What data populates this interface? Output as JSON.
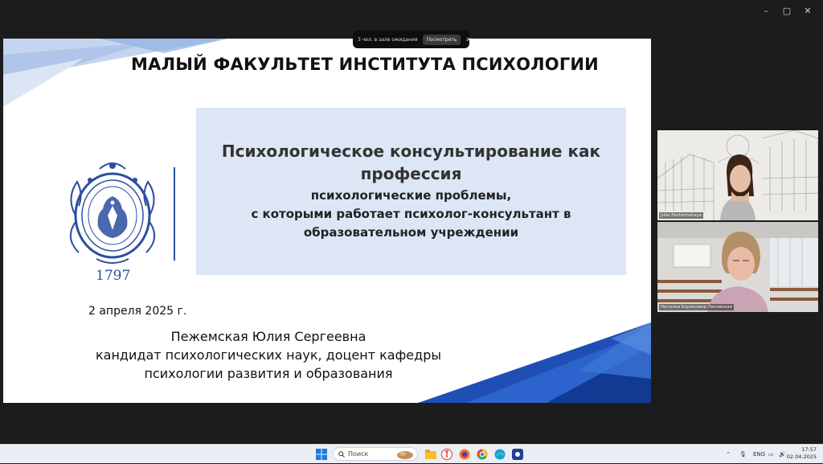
{
  "window": {
    "controls": {
      "minimize": "–",
      "maximize": "▢",
      "close": "✕"
    }
  },
  "waiting_room": {
    "text": "3 чел. в зале ожидания",
    "view_button": "Посмотреть",
    "close": "✕"
  },
  "slide": {
    "title": "МАЛЫЙ ФАКУЛЬТЕТ ИНСТИТУТА ПСИХОЛОГИИ",
    "logo_year": "1797",
    "box_title_line1": "Психологическое консультирование как",
    "box_title_line2": "профессия",
    "box_sub_line1": "психологические проблемы,",
    "box_sub_line2": "с которыми работает психолог-консультант в",
    "box_sub_line3": "образовательном учреждении",
    "date": "2 апреля 2025 г.",
    "author_name": "Пежемская Юлия Сергеевна",
    "author_title_line1": "кандидат психологических наук, доцент кафедры",
    "author_title_line2": "психологии развития и образования",
    "accent_color": "#2b4ea0"
  },
  "participants": [
    {
      "name": "Julia Pezhemskaya",
      "icon": "participant-video"
    },
    {
      "name": "Наталья Борисовна Лисовская",
      "icon": "participant-video"
    }
  ],
  "taskbar": {
    "search_placeholder": "Поиск",
    "language": "ENG",
    "time": "17:57",
    "date": "02.04.2025",
    "icons": [
      "windows-start-icon",
      "search-icon",
      "file-explorer-icon",
      "yandex-browser-icon",
      "firefox-icon",
      "chrome-icon",
      "edge-icon",
      "app-icon"
    ]
  }
}
